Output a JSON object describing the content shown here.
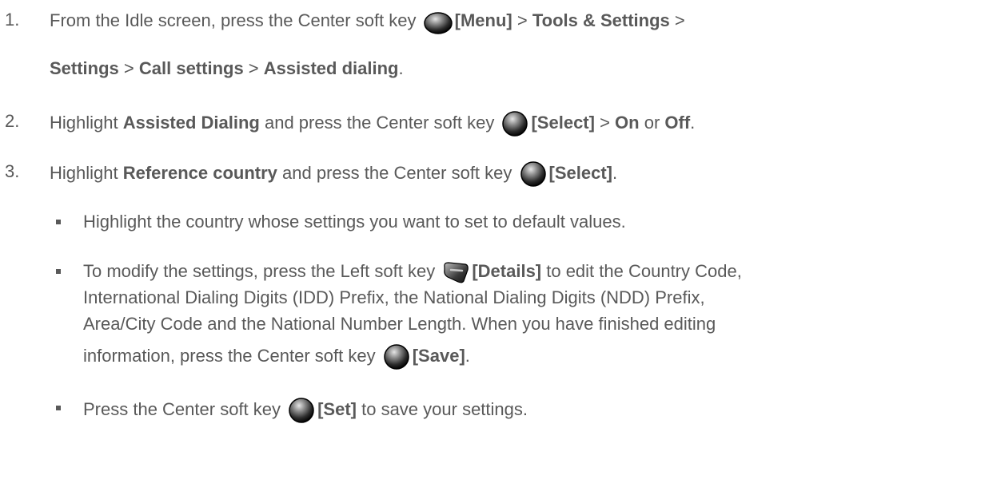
{
  "steps": [
    {
      "number": "1.",
      "line1": {
        "t1": "From the Idle screen, press the Center soft key ",
        "icon": "center-soft-key-icon",
        "b1": "[Menu]",
        "t2": " > ",
        "b2": "Tools & Settings",
        "t3": " >"
      },
      "line2": {
        "b1": "Settings",
        "t1": " > ",
        "b2": "Call settings",
        "t2": " > ",
        "b3": "Assisted dialing",
        "t3": "."
      }
    },
    {
      "number": "2.",
      "t1": "Highlight ",
      "b1": "Assisted Dialing",
      "t2": " and press the Center soft key ",
      "icon": "center-soft-key-icon",
      "b2": "[Select]",
      "t3": " > ",
      "b3": "On",
      "t4": " or ",
      "b4": "Off",
      "t5": "."
    },
    {
      "number": "3.",
      "t1": "Highlight ",
      "b1": "Reference country",
      "t2": " and press the Center soft key ",
      "icon": "center-soft-key-icon",
      "b2": "[Select]",
      "t3": "."
    }
  ],
  "bullets": [
    {
      "text": "Highlight the country whose settings you want to set to default values."
    },
    {
      "line1": {
        "t1": "To modify the settings, press the Left soft key ",
        "icon": "left-soft-key-icon",
        "b1": "[Details]",
        "t2": " to edit the Country Code,"
      },
      "line2": "International Dialing Digits (IDD) Prefix, the National Dialing Digits (NDD) Prefix,",
      "line3": "Area/City Code and the National Number Length. When you have finished editing",
      "line4": {
        "t1": "information, press the Center soft key ",
        "icon": "center-soft-key-icon",
        "b1": "[Save]",
        "t2": "."
      }
    },
    {
      "t1": "Press the Center soft key ",
      "icon": "center-soft-key-icon",
      "b1": "[Set]",
      "t2": " to save your settings."
    }
  ],
  "colors": {
    "text": "#595959",
    "key_dark": "#1a1a1a",
    "key_light": "#d0d0d0"
  }
}
